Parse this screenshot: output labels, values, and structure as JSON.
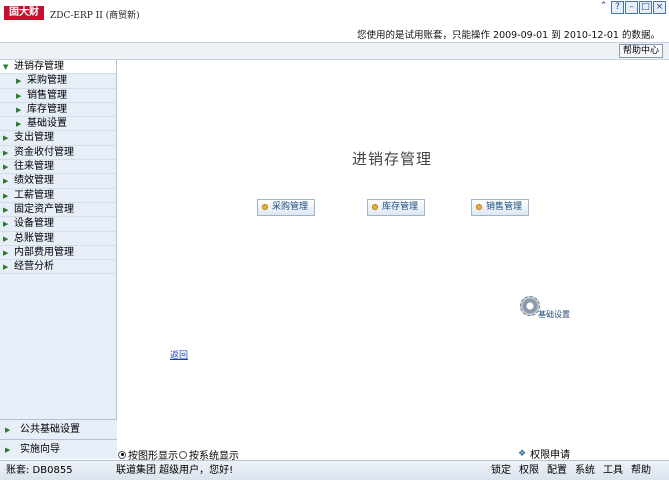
{
  "app": {
    "logo_text": "固大财",
    "title": "ZDC-ERP II (商贸新)",
    "trial_notice": "您使用的是试用账套，只能操作 2009-09-01 到 2010-12-01 的数据。"
  },
  "window_controls": [
    "collapse",
    "help",
    "minimize",
    "maximize",
    "close"
  ],
  "toolbar": {
    "help_center": "帮助中心"
  },
  "sidebar": {
    "items": [
      {
        "label": "进销存管理",
        "level": 0,
        "expanded": true
      },
      {
        "label": "采购管理",
        "level": 1
      },
      {
        "label": "销售管理",
        "level": 1
      },
      {
        "label": "库存管理",
        "level": 1
      },
      {
        "label": "基础设置",
        "level": 1
      },
      {
        "label": "支出管理",
        "level": 0
      },
      {
        "label": "资金收付管理",
        "level": 0
      },
      {
        "label": "往来管理",
        "level": 0
      },
      {
        "label": "绩效管理",
        "level": 0
      },
      {
        "label": "工薪管理",
        "level": 0
      },
      {
        "label": "固定资产管理",
        "level": 0
      },
      {
        "label": "设备管理",
        "level": 0
      },
      {
        "label": "总账管理",
        "level": 0
      },
      {
        "label": "内部费用管理",
        "level": 0
      },
      {
        "label": "经营分析",
        "level": 0
      }
    ],
    "bottom": [
      {
        "label": "公共基础设置"
      },
      {
        "label": "实施向导"
      }
    ]
  },
  "main": {
    "title": "进销存管理",
    "modules": [
      "采购管理",
      "库存管理",
      "销售管理"
    ],
    "base_settings": "基础设置",
    "back": "返回"
  },
  "options": {
    "graphic_display": "按图形显示",
    "system_display": "按系统显示",
    "selected": "graphic",
    "permission_request": "权限申请"
  },
  "status": {
    "account": "账套: DB0855",
    "welcome": "联道集团 超级用户，您好!",
    "menu": [
      "锁定",
      "权限",
      "配置",
      "系统",
      "工具",
      "帮助"
    ]
  }
}
